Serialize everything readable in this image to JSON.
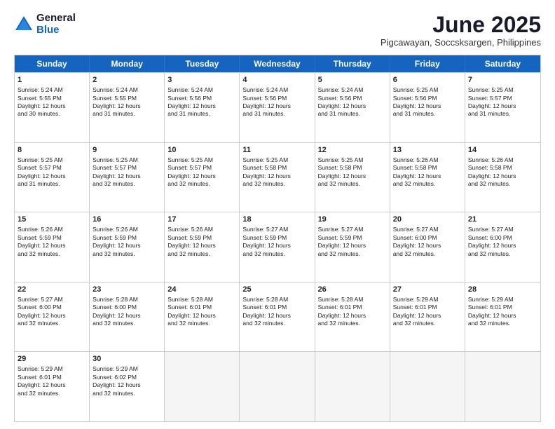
{
  "logo": {
    "general": "General",
    "blue": "Blue"
  },
  "title": "June 2025",
  "subtitle": "Pigcawayan, Soccsksargen, Philippines",
  "header_days": [
    "Sunday",
    "Monday",
    "Tuesday",
    "Wednesday",
    "Thursday",
    "Friday",
    "Saturday"
  ],
  "rows": [
    [
      {
        "day": "",
        "empty": true,
        "lines": []
      },
      {
        "day": "2",
        "lines": [
          "Sunrise: 5:24 AM",
          "Sunset: 5:55 PM",
          "Daylight: 12 hours",
          "and 31 minutes."
        ]
      },
      {
        "day": "3",
        "lines": [
          "Sunrise: 5:24 AM",
          "Sunset: 5:56 PM",
          "Daylight: 12 hours",
          "and 31 minutes."
        ]
      },
      {
        "day": "4",
        "lines": [
          "Sunrise: 5:24 AM",
          "Sunset: 5:56 PM",
          "Daylight: 12 hours",
          "and 31 minutes."
        ]
      },
      {
        "day": "5",
        "lines": [
          "Sunrise: 5:24 AM",
          "Sunset: 5:56 PM",
          "Daylight: 12 hours",
          "and 31 minutes."
        ]
      },
      {
        "day": "6",
        "lines": [
          "Sunrise: 5:25 AM",
          "Sunset: 5:56 PM",
          "Daylight: 12 hours",
          "and 31 minutes."
        ]
      },
      {
        "day": "7",
        "lines": [
          "Sunrise: 5:25 AM",
          "Sunset: 5:57 PM",
          "Daylight: 12 hours",
          "and 31 minutes."
        ]
      }
    ],
    [
      {
        "day": "8",
        "lines": [
          "Sunrise: 5:25 AM",
          "Sunset: 5:57 PM",
          "Daylight: 12 hours",
          "and 31 minutes."
        ]
      },
      {
        "day": "9",
        "lines": [
          "Sunrise: 5:25 AM",
          "Sunset: 5:57 PM",
          "Daylight: 12 hours",
          "and 32 minutes."
        ]
      },
      {
        "day": "10",
        "lines": [
          "Sunrise: 5:25 AM",
          "Sunset: 5:57 PM",
          "Daylight: 12 hours",
          "and 32 minutes."
        ]
      },
      {
        "day": "11",
        "lines": [
          "Sunrise: 5:25 AM",
          "Sunset: 5:58 PM",
          "Daylight: 12 hours",
          "and 32 minutes."
        ]
      },
      {
        "day": "12",
        "lines": [
          "Sunrise: 5:25 AM",
          "Sunset: 5:58 PM",
          "Daylight: 12 hours",
          "and 32 minutes."
        ]
      },
      {
        "day": "13",
        "lines": [
          "Sunrise: 5:26 AM",
          "Sunset: 5:58 PM",
          "Daylight: 12 hours",
          "and 32 minutes."
        ]
      },
      {
        "day": "14",
        "lines": [
          "Sunrise: 5:26 AM",
          "Sunset: 5:58 PM",
          "Daylight: 12 hours",
          "and 32 minutes."
        ]
      }
    ],
    [
      {
        "day": "15",
        "lines": [
          "Sunrise: 5:26 AM",
          "Sunset: 5:59 PM",
          "Daylight: 12 hours",
          "and 32 minutes."
        ]
      },
      {
        "day": "16",
        "lines": [
          "Sunrise: 5:26 AM",
          "Sunset: 5:59 PM",
          "Daylight: 12 hours",
          "and 32 minutes."
        ]
      },
      {
        "day": "17",
        "lines": [
          "Sunrise: 5:26 AM",
          "Sunset: 5:59 PM",
          "Daylight: 12 hours",
          "and 32 minutes."
        ]
      },
      {
        "day": "18",
        "lines": [
          "Sunrise: 5:27 AM",
          "Sunset: 5:59 PM",
          "Daylight: 12 hours",
          "and 32 minutes."
        ]
      },
      {
        "day": "19",
        "lines": [
          "Sunrise: 5:27 AM",
          "Sunset: 5:59 PM",
          "Daylight: 12 hours",
          "and 32 minutes."
        ]
      },
      {
        "day": "20",
        "lines": [
          "Sunrise: 5:27 AM",
          "Sunset: 6:00 PM",
          "Daylight: 12 hours",
          "and 32 minutes."
        ]
      },
      {
        "day": "21",
        "lines": [
          "Sunrise: 5:27 AM",
          "Sunset: 6:00 PM",
          "Daylight: 12 hours",
          "and 32 minutes."
        ]
      }
    ],
    [
      {
        "day": "22",
        "lines": [
          "Sunrise: 5:27 AM",
          "Sunset: 6:00 PM",
          "Daylight: 12 hours",
          "and 32 minutes."
        ]
      },
      {
        "day": "23",
        "lines": [
          "Sunrise: 5:28 AM",
          "Sunset: 6:00 PM",
          "Daylight: 12 hours",
          "and 32 minutes."
        ]
      },
      {
        "day": "24",
        "lines": [
          "Sunrise: 5:28 AM",
          "Sunset: 6:01 PM",
          "Daylight: 12 hours",
          "and 32 minutes."
        ]
      },
      {
        "day": "25",
        "lines": [
          "Sunrise: 5:28 AM",
          "Sunset: 6:01 PM",
          "Daylight: 12 hours",
          "and 32 minutes."
        ]
      },
      {
        "day": "26",
        "lines": [
          "Sunrise: 5:28 AM",
          "Sunset: 6:01 PM",
          "Daylight: 12 hours",
          "and 32 minutes."
        ]
      },
      {
        "day": "27",
        "lines": [
          "Sunrise: 5:29 AM",
          "Sunset: 6:01 PM",
          "Daylight: 12 hours",
          "and 32 minutes."
        ]
      },
      {
        "day": "28",
        "lines": [
          "Sunrise: 5:29 AM",
          "Sunset: 6:01 PM",
          "Daylight: 12 hours",
          "and 32 minutes."
        ]
      }
    ],
    [
      {
        "day": "29",
        "lines": [
          "Sunrise: 5:29 AM",
          "Sunset: 6:01 PM",
          "Daylight: 12 hours",
          "and 32 minutes."
        ]
      },
      {
        "day": "30",
        "lines": [
          "Sunrise: 5:29 AM",
          "Sunset: 6:02 PM",
          "Daylight: 12 hours",
          "and 32 minutes."
        ]
      },
      {
        "day": "",
        "empty": true,
        "lines": []
      },
      {
        "day": "",
        "empty": true,
        "lines": []
      },
      {
        "day": "",
        "empty": true,
        "lines": []
      },
      {
        "day": "",
        "empty": true,
        "lines": []
      },
      {
        "day": "",
        "empty": true,
        "lines": []
      }
    ]
  ],
  "first_row": [
    {
      "day": "1",
      "lines": [
        "Sunrise: 5:24 AM",
        "Sunset: 5:55 PM",
        "Daylight: 12 hours",
        "and 30 minutes."
      ]
    }
  ]
}
